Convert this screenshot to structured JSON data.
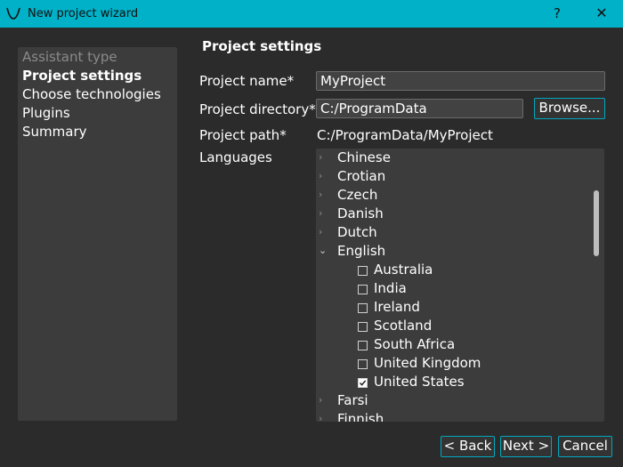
{
  "window": {
    "title": "New project wizard",
    "help": "?",
    "close": "✕"
  },
  "sidebar": {
    "items": [
      {
        "label": "Assistant type",
        "state": "muted"
      },
      {
        "label": "Project settings",
        "state": "active"
      },
      {
        "label": "Choose technologies",
        "state": "normal"
      },
      {
        "label": "Plugins",
        "state": "normal"
      },
      {
        "label": "Summary",
        "state": "normal"
      }
    ]
  },
  "form": {
    "section_title": "Project settings",
    "project_name_label": "Project name*",
    "project_name_value": "MyProject",
    "project_directory_label": "Project directory*",
    "project_directory_value": "C:/ProgramData",
    "browse_label": "Browse...",
    "project_path_label": "Project path*",
    "project_path_value": "C:/ProgramData/MyProject",
    "languages_label": "Languages"
  },
  "languages": {
    "rows": [
      {
        "label": "Chinese",
        "type": "parent",
        "expanded": false
      },
      {
        "label": "Crotian",
        "type": "parent",
        "expanded": false
      },
      {
        "label": "Czech",
        "type": "parent",
        "expanded": false
      },
      {
        "label": "Danish",
        "type": "parent",
        "expanded": false
      },
      {
        "label": "Dutch",
        "type": "parent",
        "expanded": false
      },
      {
        "label": "English",
        "type": "parent",
        "expanded": true
      },
      {
        "label": "Australia",
        "type": "child",
        "checked": false
      },
      {
        "label": "India",
        "type": "child",
        "checked": false
      },
      {
        "label": "Ireland",
        "type": "child",
        "checked": false
      },
      {
        "label": "Scotland",
        "type": "child",
        "checked": false
      },
      {
        "label": "South Africa",
        "type": "child",
        "checked": false
      },
      {
        "label": "United Kingdom",
        "type": "child",
        "checked": false
      },
      {
        "label": "United States",
        "type": "child",
        "checked": true
      },
      {
        "label": "Farsi",
        "type": "parent",
        "expanded": false
      },
      {
        "label": "Finnish",
        "type": "parent",
        "expanded": false
      }
    ]
  },
  "footer": {
    "back_label": "< Back",
    "next_label": "Next >",
    "cancel_label": "Cancel"
  },
  "colors": {
    "accent": "#00b1c8",
    "background": "#2b2b2b",
    "panel": "#3c3c3c"
  }
}
